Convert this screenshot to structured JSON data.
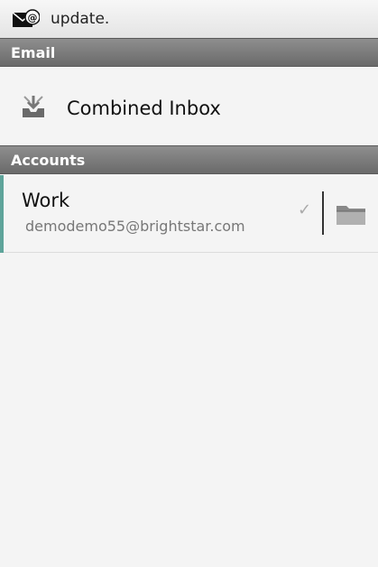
{
  "status_bar": {
    "text": "update."
  },
  "sections": {
    "email_header": "Email",
    "accounts_header": "Accounts"
  },
  "combined_inbox": {
    "label": "Combined Inbox",
    "icon": "inbox-tray-icon"
  },
  "accounts": [
    {
      "name": "Work",
      "email": "demodemo55@brightstar.com",
      "status_icon": "check-icon",
      "folder_icon": "folder-icon",
      "accent_color": "#5ea49a"
    }
  ],
  "colors": {
    "header_bg": "#7a7a7a",
    "accent": "#5ea49a",
    "background": "#f4f4f4"
  }
}
